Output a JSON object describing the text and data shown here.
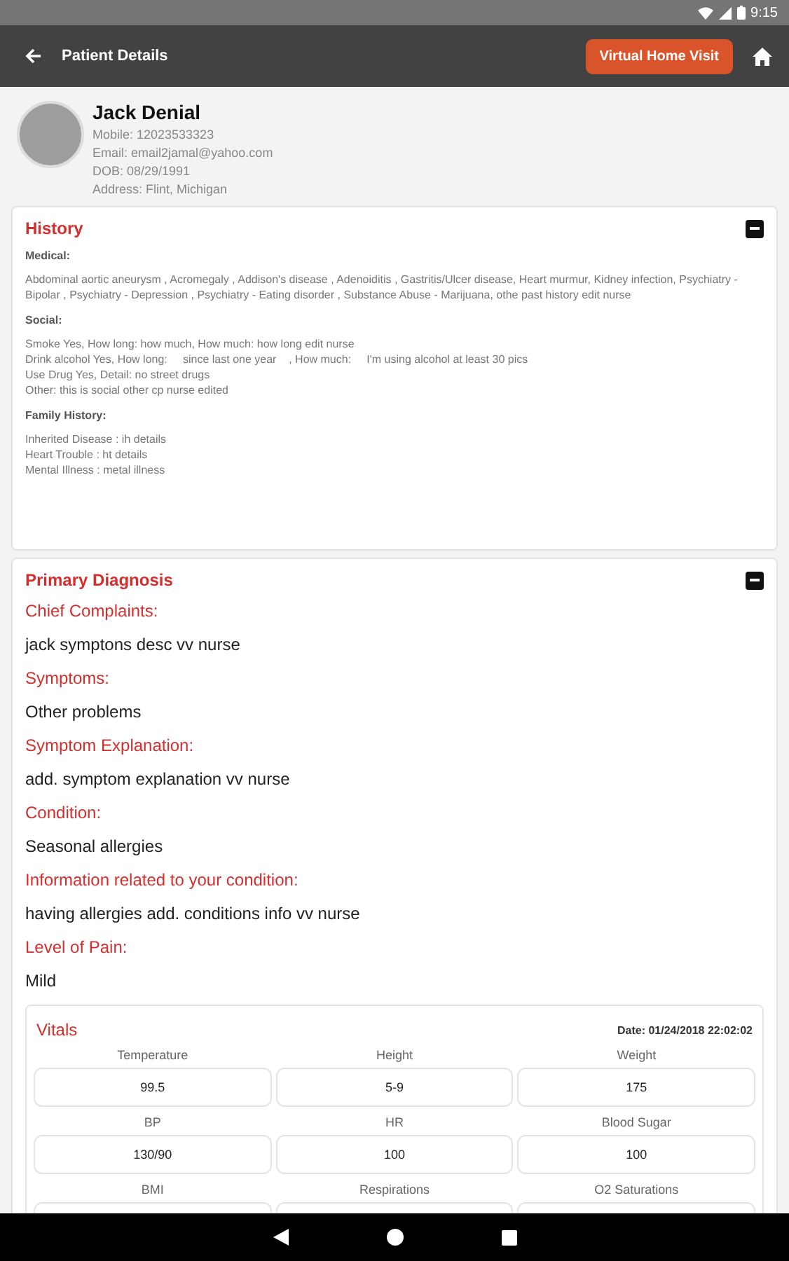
{
  "status_bar": {
    "time": "9:15"
  },
  "app_bar": {
    "title": "Patient Details",
    "action": "Virtual Home Visit"
  },
  "patient": {
    "name": "Jack Denial",
    "details": [
      "Mobile: 12023533323",
      "Email: email2jamal@yahoo.com",
      "DOB: 08/29/1991",
      "Address: Flint, Michigan"
    ]
  },
  "history": {
    "title": "History",
    "expanded": true,
    "sections": [
      {
        "heading": "Medical:",
        "lines": [
          "Abdominal aortic aneurysm , Acromegaly , Addison's disease , Adenoiditis , Gastritis/Ulcer disease, Heart murmur, Kidney infection, Psychiatry - Bipolar , Psychiatry - Depression , Psychiatry - Eating disorder , Substance Abuse - Marijuana, othe past history edit nurse"
        ]
      },
      {
        "heading": "Social:",
        "lines": [
          "Smoke Yes, How long: how much, How much: how long edit nurse",
          "Drink alcohol Yes, How long:     since last one year    , How much:     I'm using alcohol at least 30 pics",
          "Use Drug Yes, Detail: no street drugs",
          "Other: this is social other cp nurse edited"
        ]
      },
      {
        "heading": "Family History:",
        "lines": [
          "Inherited Disease : ih details",
          "Heart Trouble : ht details",
          "Mental Illness : metal illness"
        ]
      }
    ]
  },
  "diagnosis": {
    "title": "Primary Diagnosis",
    "expanded": true,
    "fields": [
      {
        "label": "Chief Complaints:",
        "value": "jack symptons desc vv nurse"
      },
      {
        "label": "Symptoms:",
        "value": "Other problems"
      },
      {
        "label": "Symptom Explanation:",
        "value": "add. symptom explanation vv nurse"
      },
      {
        "label": "Condition:",
        "value": "Seasonal allergies"
      },
      {
        "label": "Information related to your condition:",
        "value": "having allergies add. conditions info vv nurse"
      },
      {
        "label": "Level of Pain:",
        "value": "Mild"
      }
    ]
  },
  "vitals": {
    "title": "Vitals",
    "date": "Date: 01/24/2018 22:02:02",
    "items": [
      {
        "label": "Temperature",
        "value": "99.5"
      },
      {
        "label": "Height",
        "value": "5-9"
      },
      {
        "label": "Weight",
        "value": "175"
      },
      {
        "label": "BP",
        "value": "130/90"
      },
      {
        "label": "HR",
        "value": "100"
      },
      {
        "label": "Blood Sugar",
        "value": "100"
      },
      {
        "label": "BMI"
      },
      {
        "label": "Respirations"
      },
      {
        "label": "O2 Saturations"
      }
    ]
  }
}
